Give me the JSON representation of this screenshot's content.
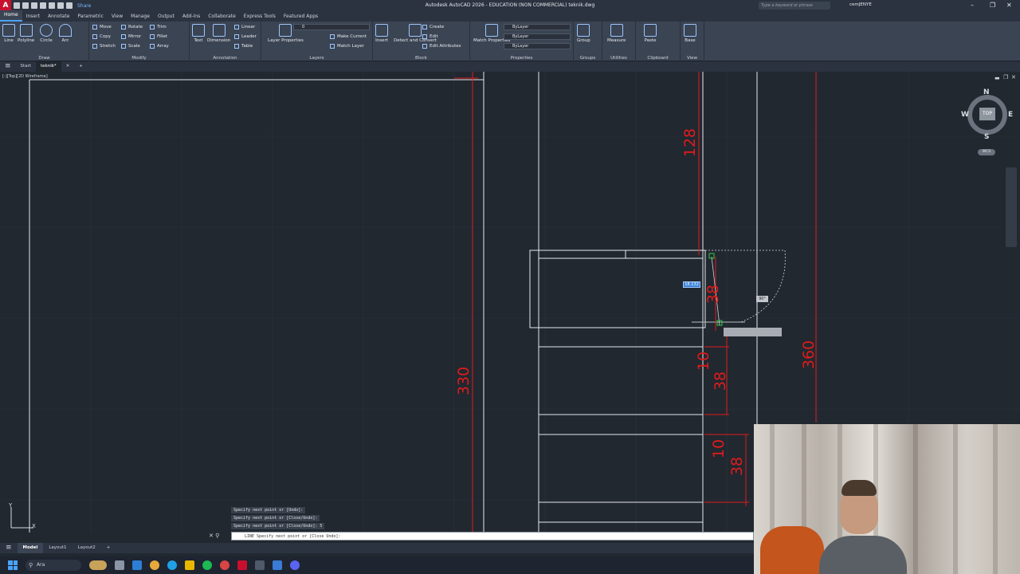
{
  "window": {
    "title": "Autodesk AutoCAD 2026 - EDUCATION (NON COMMERCIAL)   teknik.dwg",
    "search_placeholder": "Type a keyword or phrase",
    "user": "cemJENYE",
    "share_label": "Share"
  },
  "ribbon_tabs": [
    "Home",
    "Insert",
    "Annotate",
    "Parametric",
    "View",
    "Manage",
    "Output",
    "Add-ins",
    "Collaborate",
    "Express Tools",
    "Featured Apps"
  ],
  "ribbon": {
    "draw": {
      "title": "Draw",
      "line": "Line",
      "polyline": "Polyline",
      "circle": "Circle",
      "arc": "Arc"
    },
    "modify": {
      "title": "Modify",
      "move": "Move",
      "rotate": "Rotate",
      "trim": "Trim",
      "copy": "Copy",
      "mirror": "Mirror",
      "fillet": "Fillet",
      "stretch": "Stretch",
      "scale": "Scale",
      "array": "Array"
    },
    "annotation": {
      "title": "Annotation",
      "text": "Text",
      "dimension": "Dimension",
      "linear": "Linear",
      "leader": "Leader",
      "table": "Table"
    },
    "layers": {
      "title": "Layers",
      "layer_properties": "Layer Properties",
      "make_current": "Make Current",
      "match_layer": "Match Layer",
      "current_layer": "0"
    },
    "block": {
      "title": "Block",
      "insert": "Insert",
      "detect_convert": "Detect and Convert",
      "create": "Create",
      "edit": "Edit",
      "edit_attributes": "Edit Attributes"
    },
    "properties": {
      "title": "Properties",
      "match_properties": "Match Properties",
      "bylayer1": "ByLayer",
      "bylayer2": "ByLayer",
      "bylayer3": "ByLayer"
    },
    "groups": {
      "title": "Groups",
      "group": "Group"
    },
    "utilities": {
      "title": "Utilities",
      "measure": "Measure"
    },
    "clipboard": {
      "title": "Clipboard",
      "paste": "Paste"
    },
    "view": {
      "title": "View",
      "base": "Base"
    }
  },
  "file_tabs": [
    "Start",
    "teknik*"
  ],
  "viewport_label": "[-][Top][2D Wireframe]",
  "viewcube": {
    "n": "N",
    "s": "S",
    "e": "E",
    "w": "W",
    "top": "TOP",
    "wcs": "WCS"
  },
  "dimensions": {
    "d128": "128",
    "d38a": "38",
    "d360": "360",
    "d330": "330",
    "d10a": "10",
    "d38b": "38",
    "d10b": "10",
    "d38c": "38",
    "input_value": "18.132",
    "angle_label": "90°"
  },
  "command_history": [
    "Specify next point or [Undo]:",
    "Specify next point or [Close/Undo]:",
    "Specify next point or [Close/Undo]: 5"
  ],
  "command_prompt": "LINE Specify next point or [Close Undo]:",
  "layout_tabs": [
    "Model",
    "Layout1",
    "Layout2"
  ],
  "taskbar": {
    "search": "Ara"
  },
  "colors": {
    "accent": "#4aa3ff",
    "dimension_red": "#e01b1b",
    "background": "#212830"
  }
}
